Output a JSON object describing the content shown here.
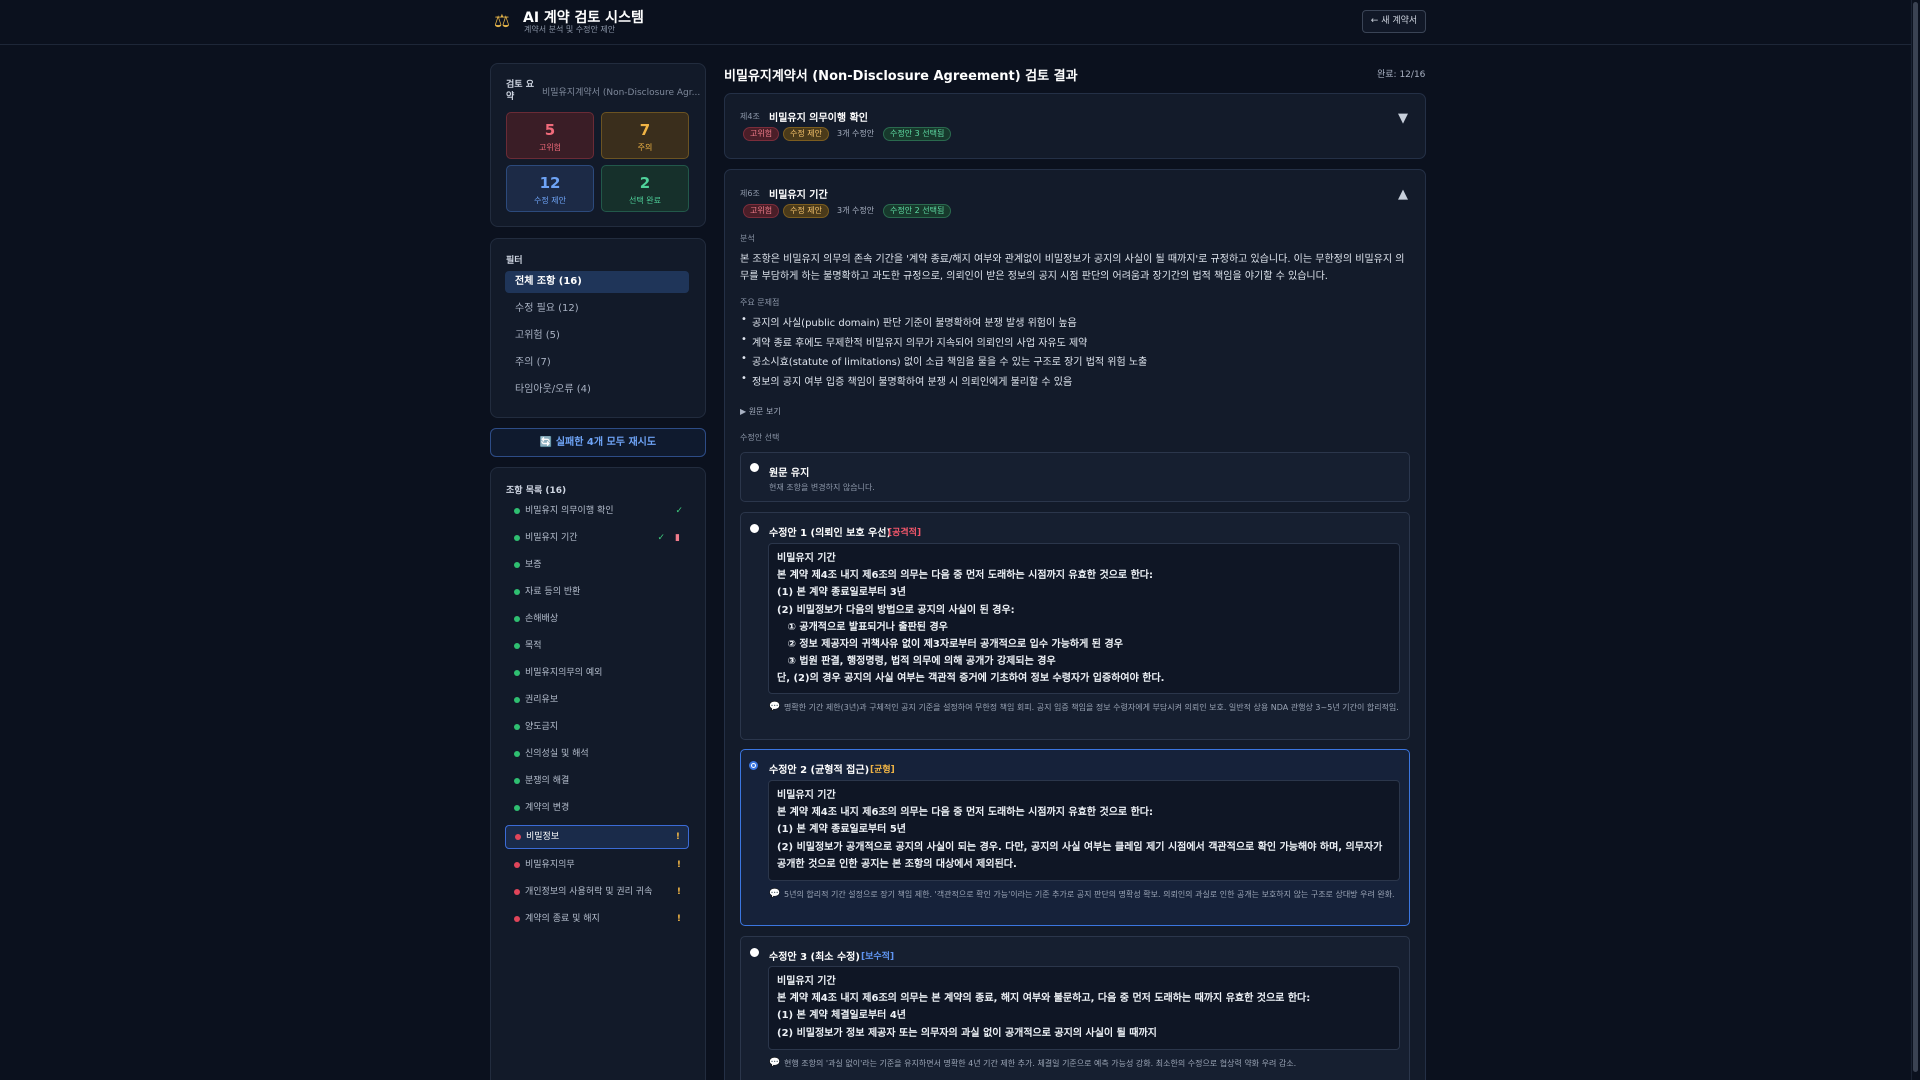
{
  "app": {
    "title": "AI 계약 검토 시스템",
    "subtitle": "계약서 분석 및 수정안 제안",
    "logo_icon": "scales-icon",
    "new_contract_label": "← 새 계약서"
  },
  "summary": {
    "title": "검토 요약",
    "doc_name": "비밀유지계약서 (Non-Disclosure Agr...",
    "stats": [
      {
        "value": "5",
        "label": "고위험",
        "color": "#f06a7a"
      },
      {
        "value": "7",
        "label": "주의",
        "color": "#f0b445"
      },
      {
        "value": "12",
        "label": "수정 제안",
        "color": "#6ea3f5"
      },
      {
        "value": "2",
        "label": "선택 완료",
        "color": "#4fd19a"
      }
    ]
  },
  "filter": {
    "title": "필터",
    "items": [
      {
        "label": "전체 조항 (16)",
        "active": true
      },
      {
        "label": "수정 필요 (12)",
        "active": false
      },
      {
        "label": "고위험 (5)",
        "active": false
      },
      {
        "label": "주의 (7)",
        "active": false
      },
      {
        "label": "타임아웃/오류 (4)",
        "active": false
      }
    ]
  },
  "retry_label": "🔄 실패한 4개 모두 재시도",
  "clause_list": {
    "title": "조항 목록 (16)",
    "items": [
      {
        "label": "비밀유지 의무이행 확인",
        "status": "green",
        "marks": "check"
      },
      {
        "label": "비밀유지 기간",
        "status": "green",
        "marks": "check-doc"
      },
      {
        "label": "보증",
        "status": "green",
        "marks": ""
      },
      {
        "label": "자료 등의 반환",
        "status": "green",
        "marks": ""
      },
      {
        "label": "손해배상",
        "status": "green",
        "marks": ""
      },
      {
        "label": "목적",
        "status": "green",
        "marks": ""
      },
      {
        "label": "비밀유지의무의 예외",
        "status": "green",
        "marks": ""
      },
      {
        "label": "권리유보",
        "status": "green",
        "marks": ""
      },
      {
        "label": "양도금지",
        "status": "green",
        "marks": ""
      },
      {
        "label": "신의성실 및 해석",
        "status": "green",
        "marks": ""
      },
      {
        "label": "분쟁의 해결",
        "status": "green",
        "marks": ""
      },
      {
        "label": "계약의 변경",
        "status": "green",
        "marks": ""
      },
      {
        "label": "비밀정보",
        "status": "red",
        "marks": "warn",
        "active": true
      },
      {
        "label": "비밀유지의무",
        "status": "red",
        "marks": "warn"
      },
      {
        "label": "개인정보의 사용허락 및 권리 귀속",
        "status": "red",
        "marks": "warn"
      },
      {
        "label": "계약의 종료 및 해지",
        "status": "red",
        "marks": "warn"
      }
    ],
    "check_glyph": "✓",
    "doc_glyph": "📄",
    "warn_glyph": "!"
  },
  "main": {
    "title": "비밀유지계약서 (Non-Disclosure Agreement) 검토 결과",
    "progress": "완료: 12/16",
    "collapsed_card": {
      "article": "제4조",
      "title": "비밀유지 의무이행 확인",
      "risk_badge": "고위험",
      "suggest_badge": "수정 제안",
      "count_text": "3개 수정안",
      "selected_badge": "수정안 3 선택됨",
      "chevron": "▼"
    },
    "expanded_card": {
      "article": "제6조",
      "title": "비밀유지 기간",
      "risk_badge": "고위험",
      "suggest_badge": "수정 제안",
      "count_text": "3개 수정안",
      "selected_badge": "수정안 2 선택됨",
      "chevron": "▲",
      "analysis_label": "분석",
      "analysis_text": "본 조항은 비밀유지 의무의 존속 기간을 '계약 종료/해지 여부와 관계없이 비밀정보가 공지의 사실이 될 때까지'로 규정하고 있습니다. 이는 무한정의 비밀유지 의무를 부담하게 하는 불명확하고 과도한 규정으로, 의뢰인이 받은 정보의 공지 시점 판단의 어려움과 장기간의 법적 책임을 야기할 수 있습니다.",
      "issues_label": "주요 문제점",
      "issues": [
        "공지의 사실(public domain) 판단 기준이 불명확하여 분쟁 발생 위험이 높음",
        "계약 종료 후에도 무제한적 비밀유지 의무가 지속되어 의뢰인의 사업 자유도 제약",
        "공소시효(statute of limitations) 없이 소급 책임을 물을 수 있는 구조로 장기 법적 위험 노출",
        "정보의 공지 여부 입증 책임이 불명확하여 분쟁 시 의뢰인에게 불리할 수 있음"
      ],
      "toggle_original": "▶ 원문 보기",
      "options_label": "수정안 선택",
      "options": [
        {
          "title": "원문 유지",
          "sub": "현재 조항을 변경하지 않습니다."
        },
        {
          "title": "수정안 1 (의뢰인 보호 우선)",
          "tag": "[공격적]",
          "text": "비밀유지 기간\n본 계약 제4조 내지 제6조의 의무는 다음 중 먼저 도래하는 시점까지 유효한 것으로 한다:\n(1) 본 계약 종료일로부터 3년\n(2) 비밀정보가 다음의 방법으로 공지의 사실이 된 경우:\n   ① 공개적으로 발표되거나 출판된 경우\n   ② 정보 제공자의 귀책사유 없이 제3자로부터 공개적으로 입수 가능하게 된 경우\n   ③ 법원 판결, 행정명령, 법적 의무에 의해 공개가 강제되는 경우\n단, (2)의 경우 공지의 사실 여부는 객관적 증거에 기초하여 정보 수령자가 입증하여야 한다.",
          "note": "명확한 기간 제한(3년)과 구체적인 공지 기준을 설정하여 무한정 책임 회피. 공지 입증 책임을 정보 수령자에게 부담시켜 의뢰인 보호. 일반적 상용 NDA 관행상 3~5년 기간이 합리적임."
        },
        {
          "title": "수정안 2 (균형적 접근)",
          "tag": "[균형]",
          "text": "비밀유지 기간\n본 계약 제4조 내지 제6조의 의무는 다음 중 먼저 도래하는 시점까지 유효한 것으로 한다:\n(1) 본 계약 종료일로부터 5년\n(2) 비밀정보가 공개적으로 공지의 사실이 되는 경우. 다만, 공지의 사실 여부는 클레임 제기 시점에서 객관적으로 확인 가능해야 하며, 의무자가 공개한 것으로 인한 공지는 본 조항의 대상에서 제외된다.",
          "note": "5년의 합리적 기간 설정으로 장기 책임 제한. '객관적으로 확인 가능'이라는 기준 추가로 공지 판단의 명확성 확보. 의뢰인의 과실로 인한 공개는 보호하지 않는 구조로 상대방 우려 완화."
        },
        {
          "title": "수정안 3 (최소 수정)",
          "tag": "[보수적]",
          "text": "비밀유지 기간\n본 계약 제4조 내지 제6조의 의무는 본 계약의 종료, 해지 여부와 불문하고, 다음 중 먼저 도래하는 때까지 유효한 것으로 한다:\n(1) 본 계약 체결일로부터 4년\n(2) 비밀정보가 정보 제공자 또는 의무자의 과실 없이 공개적으로 공지의 사실이 될 때까지",
          "note": "현행 조항의 '과실 없이'라는 기준을 유지하면서 명확한 4년 기간 제한 추가. 체결일 기준으로 예측 가능성 강화. 최소한의 수정으로 협상력 약화 우려 감소."
        }
      ]
    }
  }
}
